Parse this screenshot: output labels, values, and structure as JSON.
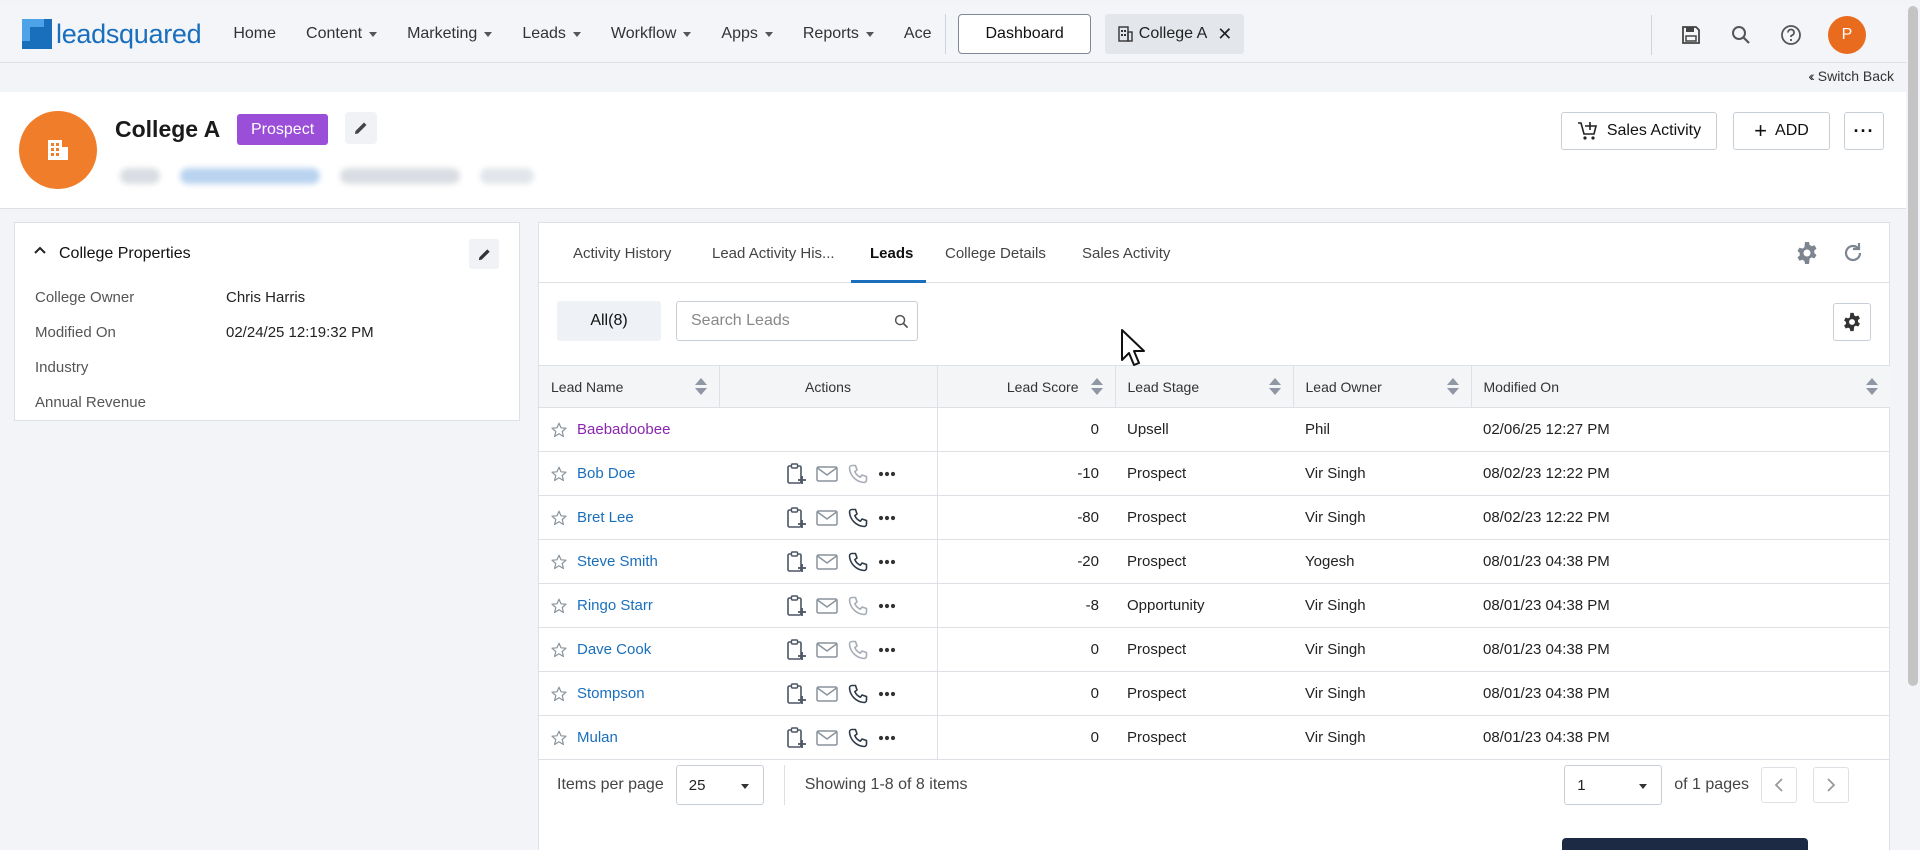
{
  "app": {
    "logo_text": "leadsquared",
    "brand_color": "#1a6fbd"
  },
  "nav": {
    "items": [
      {
        "label": "Home",
        "dropdown": false
      },
      {
        "label": "Content",
        "dropdown": true
      },
      {
        "label": "Marketing",
        "dropdown": true
      },
      {
        "label": "Leads",
        "dropdown": true
      },
      {
        "label": "Workflow",
        "dropdown": true
      },
      {
        "label": "Apps",
        "dropdown": true
      },
      {
        "label": "Reports",
        "dropdown": true
      },
      {
        "label": "Ace",
        "dropdown": false
      }
    ],
    "dashboard_label": "Dashboard",
    "open_tab_label": "College A",
    "user_initial": "P",
    "switch_back": "Switch Back"
  },
  "header": {
    "name": "College A",
    "badge": "Prospect",
    "badge_color": "#9b4ed8",
    "sales_activity_label": "Sales Activity",
    "add_label": "ADD"
  },
  "properties": {
    "title": "College Properties",
    "rows": [
      {
        "label": "College Owner",
        "value": "Chris Harris"
      },
      {
        "label": "Modified On",
        "value": "02/24/25 12:19:32 PM"
      },
      {
        "label": "Industry",
        "value": ""
      },
      {
        "label": "Annual Revenue",
        "value": ""
      }
    ]
  },
  "tabs": [
    {
      "label": "Activity History",
      "active": false
    },
    {
      "label": "Lead Activity His...",
      "active": false
    },
    {
      "label": "Leads",
      "active": true
    },
    {
      "label": "College Details",
      "active": false
    },
    {
      "label": "Sales Activity",
      "active": false
    }
  ],
  "leads": {
    "all_label": "All(8)",
    "search_placeholder": "Search Leads",
    "columns": [
      "Lead Name",
      "Actions",
      "Lead Score",
      "Lead Stage",
      "Lead Owner",
      "Modified On"
    ],
    "rows": [
      {
        "name": "Baebadoobee",
        "visited": true,
        "actions": false,
        "phone_active": false,
        "score": "0",
        "stage": "Upsell",
        "owner": "Phil",
        "modified": "02/06/25 12:27 PM"
      },
      {
        "name": "Bob Doe",
        "visited": false,
        "actions": true,
        "phone_active": false,
        "score": "-10",
        "stage": "Prospect",
        "owner": "Vir Singh",
        "modified": "08/02/23 12:22 PM"
      },
      {
        "name": "Bret Lee",
        "visited": false,
        "actions": true,
        "phone_active": true,
        "score": "-80",
        "stage": "Prospect",
        "owner": "Vir Singh",
        "modified": "08/02/23 12:22 PM"
      },
      {
        "name": "Steve Smith",
        "visited": false,
        "actions": true,
        "phone_active": true,
        "score": "-20",
        "stage": "Prospect",
        "owner": "Yogesh",
        "modified": "08/01/23 04:38 PM"
      },
      {
        "name": "Ringo Starr",
        "visited": false,
        "actions": true,
        "phone_active": false,
        "score": "-8",
        "stage": "Opportunity",
        "owner": "Vir Singh",
        "modified": "08/01/23 04:38 PM"
      },
      {
        "name": "Dave Cook",
        "visited": false,
        "actions": true,
        "phone_active": false,
        "score": "0",
        "stage": "Prospect",
        "owner": "Vir Singh",
        "modified": "08/01/23 04:38 PM"
      },
      {
        "name": "Stompson",
        "visited": false,
        "actions": true,
        "phone_active": true,
        "score": "0",
        "stage": "Prospect",
        "owner": "Vir Singh",
        "modified": "08/01/23 04:38 PM"
      },
      {
        "name": "Mulan",
        "visited": false,
        "actions": true,
        "phone_active": true,
        "score": "0",
        "stage": "Prospect",
        "owner": "Vir Singh",
        "modified": "08/01/23 04:38 PM"
      }
    ]
  },
  "pager": {
    "items_per_page_label": "Items per page",
    "items_per_page": "25",
    "showing": "Showing 1-8 of 8 items",
    "page": "1",
    "of_pages": "of 1 pages"
  }
}
